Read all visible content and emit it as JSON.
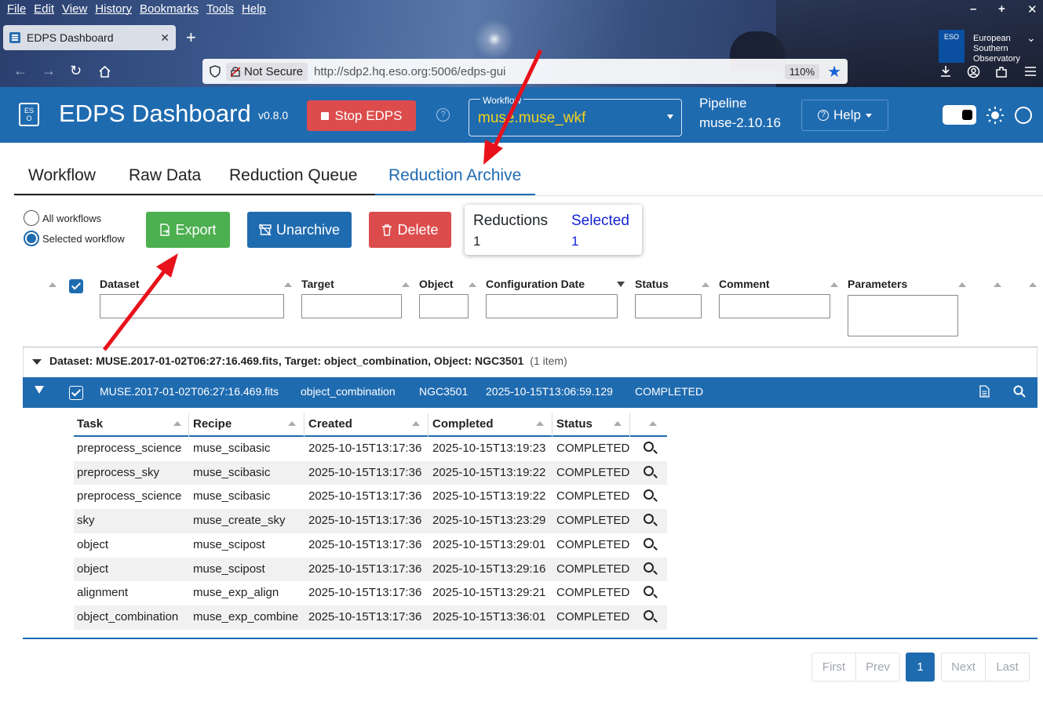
{
  "browser": {
    "menu": [
      "File",
      "Edit",
      "View",
      "History",
      "Bookmarks",
      "Tools",
      "Help"
    ],
    "tab_title": "EDPS Dashboard",
    "security_label": "Not Secure",
    "url": "http://sdp2.hq.eso.org:5006/edps-gui",
    "zoom": "110%",
    "eso_badge": "ESO",
    "eso_text": [
      "European",
      "Southern",
      "Observatory"
    ],
    "icons": [
      "back-icon",
      "forward-icon",
      "reload-icon",
      "home-icon",
      "shield-icon",
      "lock-icon",
      "star-icon",
      "download-icon",
      "account-icon",
      "extensions-icon",
      "menu-icon"
    ]
  },
  "app": {
    "title": "EDPS Dashboard",
    "version": "v0.8.0",
    "stop_label": "Stop EDPS",
    "workflow_label": "Workflow",
    "workflow_value": "muse.muse_wkf",
    "pipeline_label": "Pipeline",
    "pipeline_value": "muse-2.10.16",
    "help_label": "Help",
    "colors": {
      "header": "#1f6bb0",
      "workflow_value": "#f5d21a",
      "danger": "#dc4c4c",
      "success": "#4caf50"
    }
  },
  "tabs": [
    "Workflow",
    "Raw Data",
    "Reduction Queue",
    "Reduction Archive"
  ],
  "active_tab": "Reduction Archive",
  "toolbar": {
    "radio_all": "All workflows",
    "radio_selected": "Selected workflow",
    "selected_radio": "Selected workflow",
    "export": "Export",
    "unarchive": "Unarchive",
    "delete": "Delete",
    "reductions_label": "Reductions",
    "reductions_value": "1",
    "selected_label": "Selected",
    "selected_value": "1"
  },
  "grid": {
    "columns": [
      "Dataset",
      "Target",
      "Object",
      "Configuration Date",
      "Status",
      "Comment",
      "Parameters"
    ],
    "sorted_column": "Configuration Date",
    "sort_direction": "descending",
    "group": {
      "text": "Dataset: MUSE.2017-01-02T06:27:16.469.fits, Target: object_combination, Object: NGC3501",
      "count": "(1 item)"
    },
    "row": {
      "dataset": "MUSE.2017-01-02T06:27:16.469.fits",
      "target": "object_combination",
      "object": "NGC3501",
      "config_date": "2025-10-15T13:06:59.129",
      "status": "COMPLETED",
      "checked": true
    }
  },
  "subtable": {
    "columns": [
      "Task",
      "Recipe",
      "Created",
      "Completed",
      "Status"
    ],
    "rows": [
      {
        "task": "preprocess_science",
        "recipe": "muse_scibasic",
        "created": "2025-10-15T13:17:36",
        "completed": "2025-10-15T13:19:23",
        "status": "COMPLETED"
      },
      {
        "task": "preprocess_sky",
        "recipe": "muse_scibasic",
        "created": "2025-10-15T13:17:36",
        "completed": "2025-10-15T13:19:22",
        "status": "COMPLETED"
      },
      {
        "task": "preprocess_science",
        "recipe": "muse_scibasic",
        "created": "2025-10-15T13:17:36",
        "completed": "2025-10-15T13:19:22",
        "status": "COMPLETED"
      },
      {
        "task": "sky",
        "recipe": "muse_create_sky",
        "created": "2025-10-15T13:17:36",
        "completed": "2025-10-15T13:23:29",
        "status": "COMPLETED"
      },
      {
        "task": "object",
        "recipe": "muse_scipost",
        "created": "2025-10-15T13:17:36",
        "completed": "2025-10-15T13:29:01",
        "status": "COMPLETED"
      },
      {
        "task": "object",
        "recipe": "muse_scipost",
        "created": "2025-10-15T13:17:36",
        "completed": "2025-10-15T13:29:16",
        "status": "COMPLETED"
      },
      {
        "task": "alignment",
        "recipe": "muse_exp_align",
        "created": "2025-10-15T13:17:36",
        "completed": "2025-10-15T13:29:21",
        "status": "COMPLETED"
      },
      {
        "task": "object_combination",
        "recipe": "muse_exp_combine",
        "created": "2025-10-15T13:17:36",
        "completed": "2025-10-15T13:36:01",
        "status": "COMPLETED"
      }
    ]
  },
  "pagination": {
    "first": "First",
    "prev": "Prev",
    "current": "1",
    "next": "Next",
    "last": "Last"
  }
}
